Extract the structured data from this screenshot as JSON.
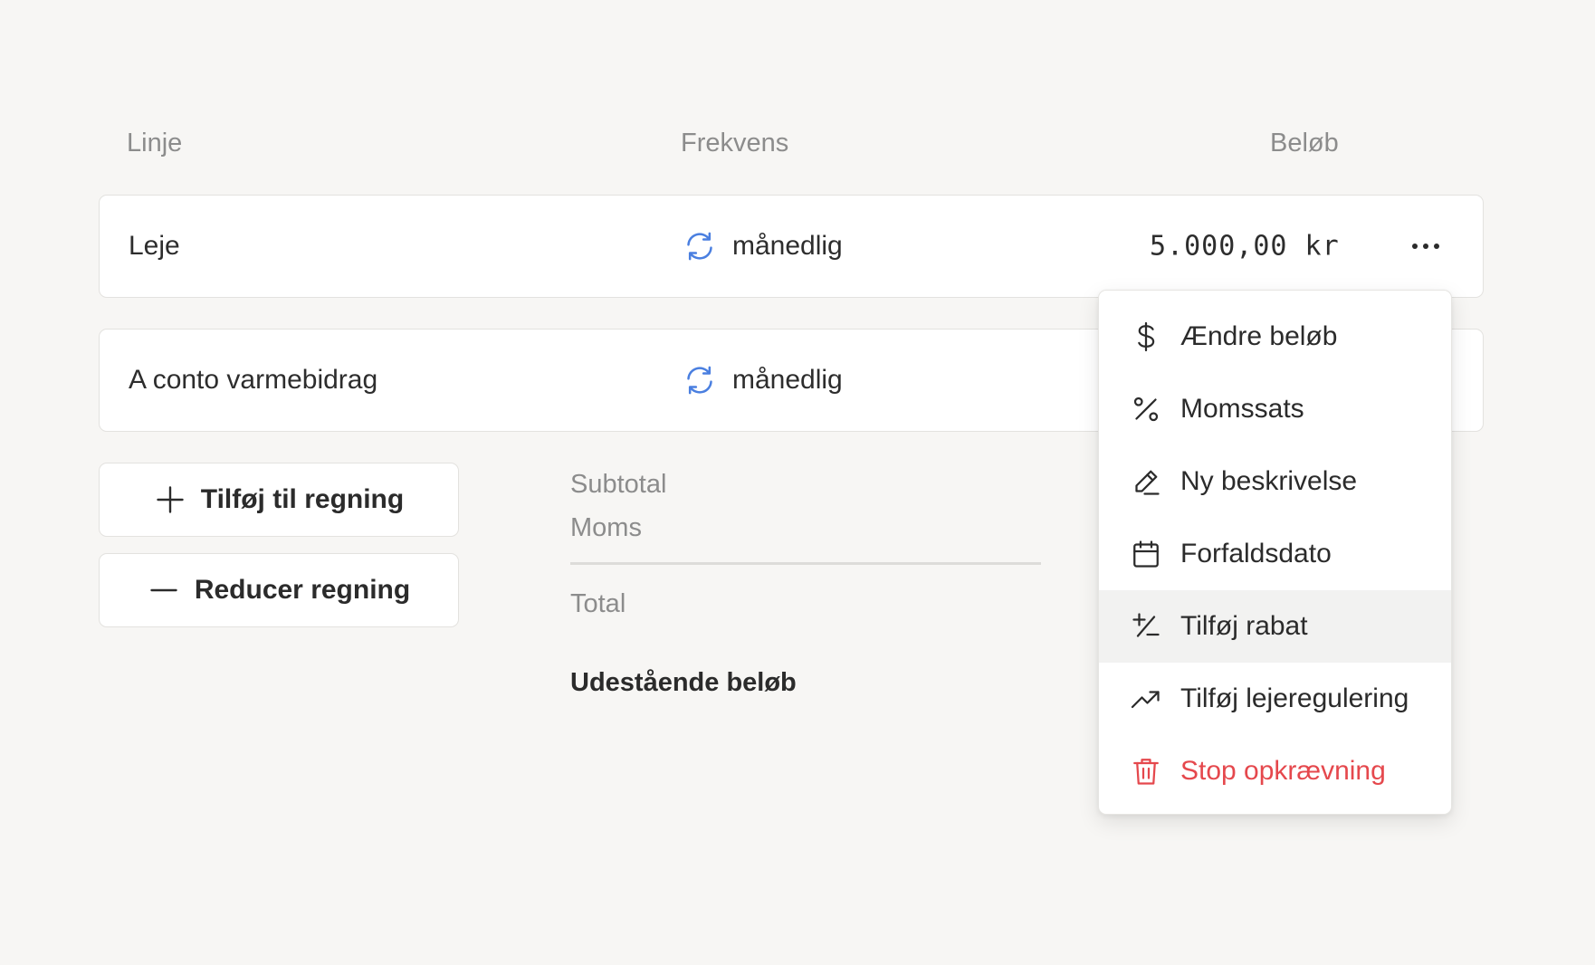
{
  "table_headers": {
    "line": "Linje",
    "frequency": "Frekvens",
    "amount": "Beløb"
  },
  "rows": [
    {
      "label": "Leje",
      "frequency": "månedlig",
      "amount": "5.000,00 kr"
    },
    {
      "label": "A conto varmebidrag",
      "frequency": "månedlig"
    }
  ],
  "buttons": {
    "add": "Tilføj til regning",
    "reduce": "Reducer regning"
  },
  "summary": {
    "subtotal": "Subtotal",
    "moms": "Moms",
    "total": "Total",
    "outstanding": "Udestående beløb"
  },
  "menu": {
    "items": [
      {
        "label": "Ændre beløb",
        "icon": "dollar-icon"
      },
      {
        "label": "Momssats",
        "icon": "percent-icon"
      },
      {
        "label": "Ny beskrivelse",
        "icon": "pencil-icon"
      },
      {
        "label": "Forfaldsdato",
        "icon": "calendar-icon"
      },
      {
        "label": "Tilføj rabat",
        "icon": "plus-minus-icon",
        "active": true
      },
      {
        "label": "Tilføj lejeregulering",
        "icon": "trending-up-icon"
      },
      {
        "label": "Stop opkrævning",
        "icon": "trash-icon",
        "danger": true
      }
    ]
  },
  "colors": {
    "background": "#f7f6f4",
    "accent_blue": "#4a7fe0",
    "danger_red": "#e5484d",
    "muted_text": "#8c8c8c"
  }
}
